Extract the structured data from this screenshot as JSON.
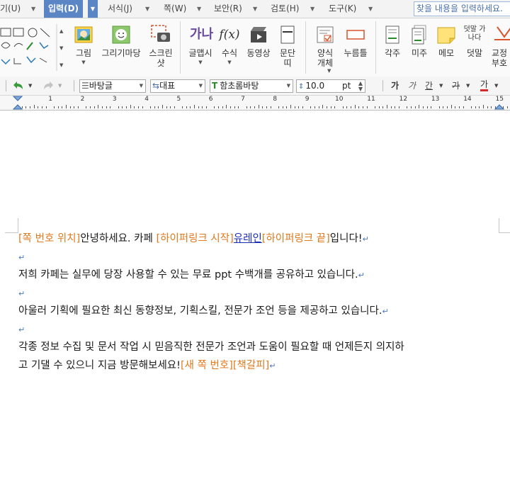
{
  "menubar": {
    "items": [
      {
        "label": "기(U)"
      },
      {
        "label": "입력(D)",
        "active": true
      },
      {
        "label": "서식(J)"
      },
      {
        "label": "쪽(W)"
      },
      {
        "label": "보안(R)"
      },
      {
        "label": "검토(H)"
      },
      {
        "label": "도구(K)"
      }
    ],
    "search_placeholder": "찾을 내용을 입력하세요."
  },
  "ribbon": {
    "buttons": [
      {
        "label": "그림",
        "icon": "picture-icon"
      },
      {
        "label": "그리기마당",
        "icon": "drawing-gallery-icon"
      },
      {
        "label": "스크린샷",
        "icon": "screenshot-icon"
      },
      {
        "label": "글맵시",
        "icon": "wordart-icon",
        "glyph": "가나"
      },
      {
        "label": "수식",
        "icon": "formula-icon",
        "glyph": "f(x)"
      },
      {
        "label": "동영상",
        "icon": "video-icon"
      },
      {
        "label": "문단띠",
        "icon": "paragraph-band-icon"
      },
      {
        "label": "양식개체",
        "icon": "form-object-icon"
      },
      {
        "label": "누름틀",
        "icon": "field-icon"
      },
      {
        "label": "각주",
        "icon": "footnote-icon"
      },
      {
        "label": "미주",
        "icon": "endnote-icon"
      },
      {
        "label": "메모",
        "icon": "memo-icon"
      },
      {
        "label": "덧말",
        "icon": "ruby-text-icon",
        "glyph": "덧말 가나다"
      },
      {
        "label": "교정부호",
        "icon": "proofread-icon"
      }
    ]
  },
  "format": {
    "style": "바탕글",
    "lang": "대표",
    "font": "함초롬바탕",
    "size": "10.0",
    "unit": "pt",
    "bold": "가",
    "italic": "가",
    "underline": "간",
    "strike": "가",
    "color": "가"
  },
  "ruler": {
    "numbers": [
      "1",
      "2",
      "3",
      "4",
      "5",
      "6",
      "7",
      "8",
      "9",
      "10",
      "11",
      "12",
      "13",
      "14",
      "15"
    ]
  },
  "document": {
    "line1": {
      "field1": "[쪽 번호 위치]",
      "text1": "안녕하세요. 카페 ",
      "field2": "[하이퍼링크 시작]",
      "link": "유레인",
      "field3": "[하이퍼링크 끝]",
      "text2": "입니다!"
    },
    "line3": "저희 카페는 실무에 당장 사용할 수 있는 무료 ppt 수백개를 공유하고 있습니다.",
    "line5": "아울러 기획에 필요한 최신 동향정보, 기획스킬, 전문가 조언 등을 제공하고 있습니다.",
    "line7a": "각종 정보 수집 및 문서 작업 시 믿음직한 전문가 조언과 도움이 필요할 때 언제든지 의지하",
    "line7b": "고 기댈 수 있으니 지금 방문해보세요!",
    "field4": "[새 쪽 번호]",
    "field5": "[책갈피]"
  },
  "colors": {
    "field": "#e07a1f",
    "link": "#1a2fb4",
    "mark": "#4a78c8",
    "accent": "#5b86c6"
  }
}
